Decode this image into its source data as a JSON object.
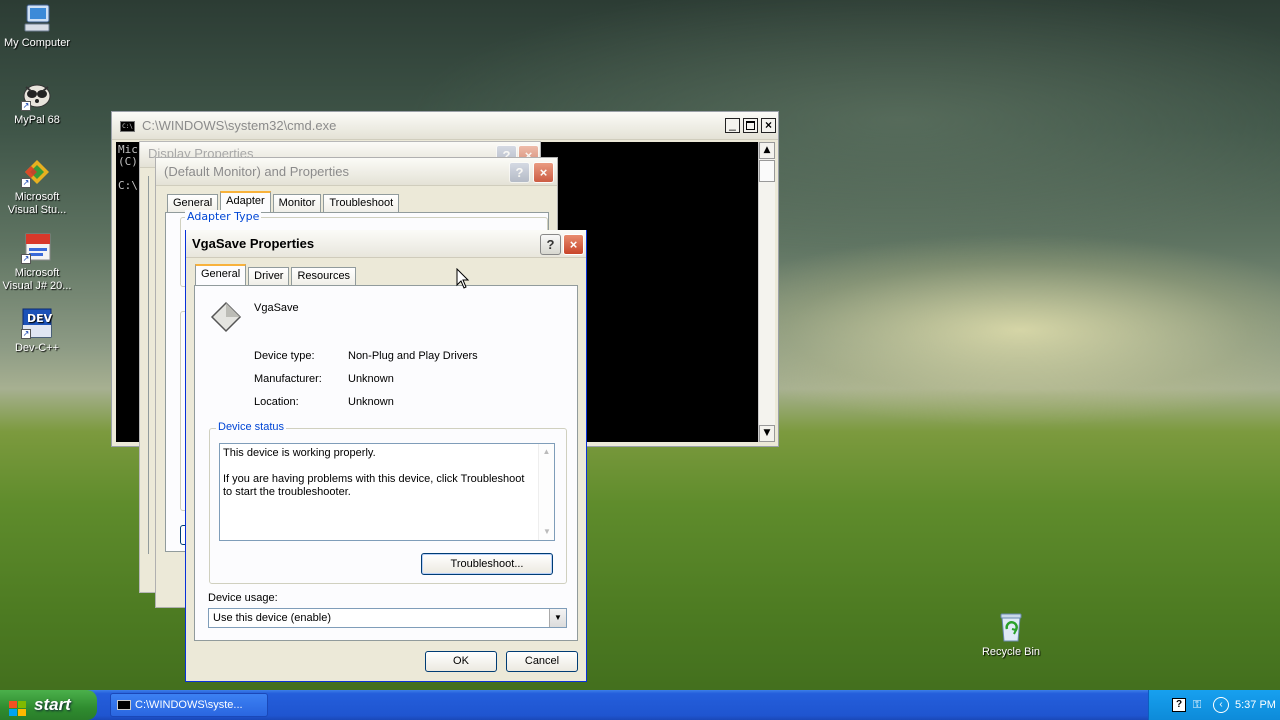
{
  "desktop_icons": [
    {
      "label": "My Computer",
      "icon": "my-computer-icon"
    },
    {
      "label": "MyPal 68",
      "icon": "mypal-icon"
    },
    {
      "label": "Microsoft Visual Stu...",
      "icon": "visual-studio-icon"
    },
    {
      "label": "Microsoft Visual J# 20...",
      "icon": "visual-jsharp-icon"
    },
    {
      "label": "Dev-C++",
      "icon": "devcpp-icon"
    },
    {
      "label": "Recycle Bin",
      "icon": "recycle-bin-icon"
    }
  ],
  "cmd": {
    "title": "C:\\WINDOWS\\system32\\cmd.exe",
    "icon_text": "C:\\",
    "lines": [
      "Mic",
      "(C)",
      "",
      "C:\\"
    ]
  },
  "display_properties": {
    "title": "Display Properties"
  },
  "monitor_properties": {
    "title": "(Default Monitor) and  Properties",
    "tabs": [
      "General",
      "Adapter",
      "Monitor",
      "Troubleshoot"
    ],
    "active_tab": "Adapter",
    "group_adapter_type": "Adapter Type"
  },
  "vgasave": {
    "title": "VgaSave Properties",
    "tabs": [
      "General",
      "Driver",
      "Resources"
    ],
    "active_tab": "General",
    "device_name": "VgaSave",
    "props": [
      {
        "label": "Device type:",
        "value": "Non-Plug and Play Drivers"
      },
      {
        "label": "Manufacturer:",
        "value": "Unknown"
      },
      {
        "label": "Location:",
        "value": "Unknown"
      }
    ],
    "device_status_label": "Device status",
    "status_line1": "This device is working properly.",
    "status_line2": "If you are having problems with this device, click Troubleshoot to start the troubleshooter.",
    "troubleshoot_button": "Troubleshoot...",
    "device_usage_label": "Device usage:",
    "device_usage_value": "Use this device (enable)",
    "ok_button": "OK",
    "cancel_button": "Cancel"
  },
  "taskbar": {
    "start_label": "start",
    "task_label": "C:\\WINDOWS\\syste...",
    "clock": "5:37 PM"
  }
}
